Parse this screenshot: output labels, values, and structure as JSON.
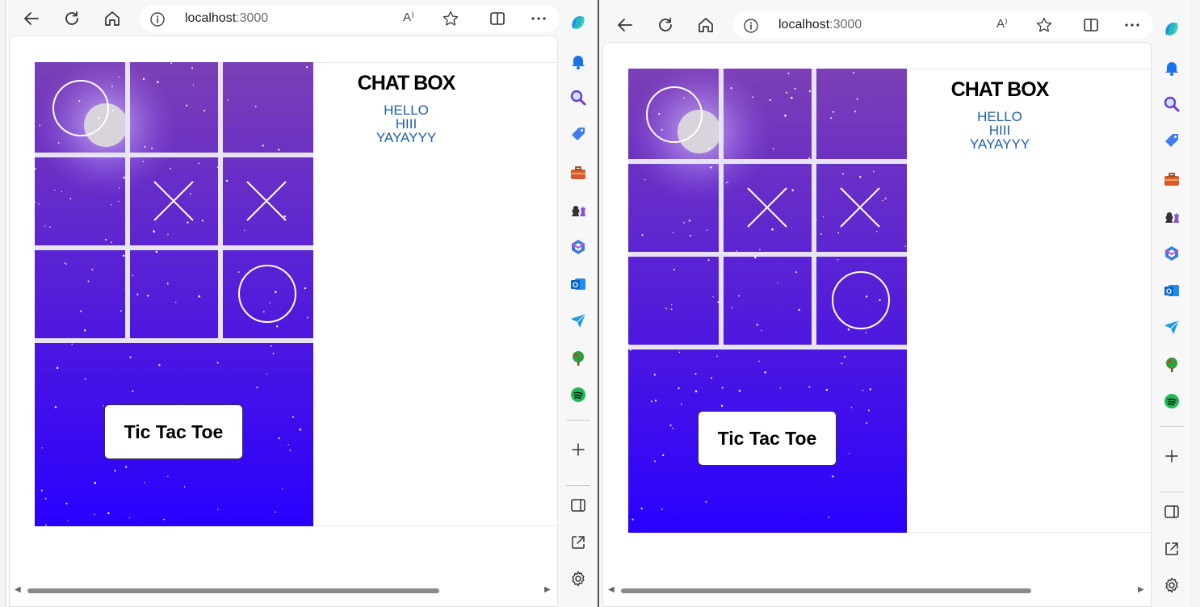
{
  "left_window": {
    "address": {
      "host": "localhost",
      "port": ":3000"
    },
    "read_aloud_label": "A⁾",
    "page": {
      "chat": {
        "title": "CHAT BOX",
        "messages": [
          "HELLO",
          "HIII",
          "YAYAYYY"
        ]
      },
      "game": {
        "button_label": "Tic Tac Toe",
        "board": [
          "O",
          "",
          "",
          "",
          "X",
          "X",
          "",
          "",
          "O"
        ]
      }
    }
  },
  "right_window": {
    "address": {
      "host": "localhost",
      "port": ":3000"
    },
    "read_aloud_label": "A⁾",
    "page": {
      "chat": {
        "title": "CHAT BOX",
        "messages": [
          "HELLO",
          "HIII",
          "YAYAYYY"
        ]
      },
      "game": {
        "button_label": "Tic Tac Toe",
        "board": [
          "O",
          "",
          "",
          "",
          "X",
          "X",
          "",
          "",
          "O"
        ]
      }
    }
  },
  "toolbar_icons": [
    "back-icon",
    "refresh-icon",
    "home-icon",
    "info-icon",
    "read-aloud-icon",
    "favorite-star-icon",
    "split-screen-icon",
    "more-icon"
  ],
  "sidebar_icons": [
    "copilot-icon",
    "notifications-bell-icon",
    "search-icon",
    "shopping-tag-icon",
    "tools-briefcase-icon",
    "games-chess-icon",
    "microsoft365-icon",
    "outlook-icon",
    "send-icon",
    "tree-icon",
    "spotify-icon",
    "add-icon",
    "sidebar-panel-icon",
    "external-window-icon",
    "settings-gear-icon"
  ],
  "colors": {
    "board_top": "#7b3fb5",
    "board_bottom": "#2a00ff",
    "board_gap": "#e8e4f7",
    "chat_text": "#1f5ea8",
    "moon": "#d9d4dc"
  }
}
